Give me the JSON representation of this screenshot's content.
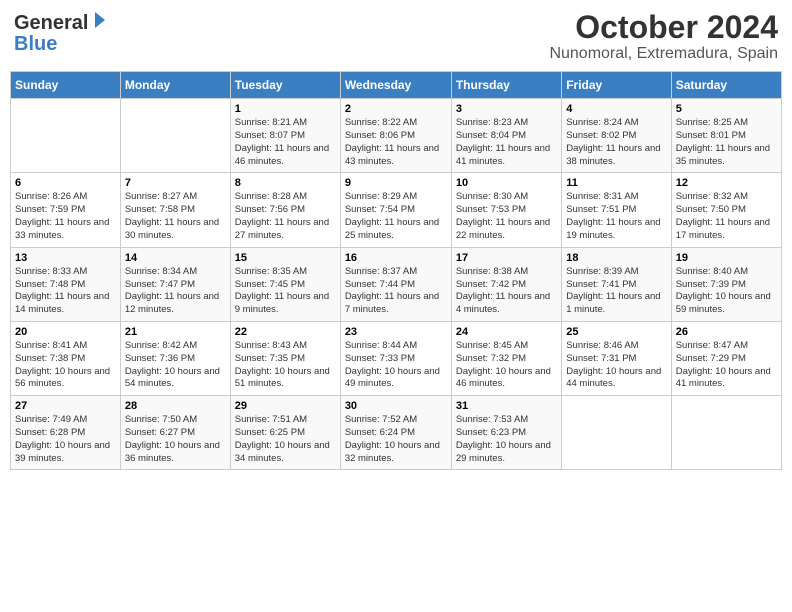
{
  "logo": {
    "general": "General",
    "blue": "Blue"
  },
  "title": "October 2024",
  "subtitle": "Nunomoral, Extremadura, Spain",
  "weekdays": [
    "Sunday",
    "Monday",
    "Tuesday",
    "Wednesday",
    "Thursday",
    "Friday",
    "Saturday"
  ],
  "weeks": [
    [
      {
        "day": "",
        "info": ""
      },
      {
        "day": "",
        "info": ""
      },
      {
        "day": "1",
        "info": "Sunrise: 8:21 AM\nSunset: 8:07 PM\nDaylight: 11 hours and 46 minutes."
      },
      {
        "day": "2",
        "info": "Sunrise: 8:22 AM\nSunset: 8:06 PM\nDaylight: 11 hours and 43 minutes."
      },
      {
        "day": "3",
        "info": "Sunrise: 8:23 AM\nSunset: 8:04 PM\nDaylight: 11 hours and 41 minutes."
      },
      {
        "day": "4",
        "info": "Sunrise: 8:24 AM\nSunset: 8:02 PM\nDaylight: 11 hours and 38 minutes."
      },
      {
        "day": "5",
        "info": "Sunrise: 8:25 AM\nSunset: 8:01 PM\nDaylight: 11 hours and 35 minutes."
      }
    ],
    [
      {
        "day": "6",
        "info": "Sunrise: 8:26 AM\nSunset: 7:59 PM\nDaylight: 11 hours and 33 minutes."
      },
      {
        "day": "7",
        "info": "Sunrise: 8:27 AM\nSunset: 7:58 PM\nDaylight: 11 hours and 30 minutes."
      },
      {
        "day": "8",
        "info": "Sunrise: 8:28 AM\nSunset: 7:56 PM\nDaylight: 11 hours and 27 minutes."
      },
      {
        "day": "9",
        "info": "Sunrise: 8:29 AM\nSunset: 7:54 PM\nDaylight: 11 hours and 25 minutes."
      },
      {
        "day": "10",
        "info": "Sunrise: 8:30 AM\nSunset: 7:53 PM\nDaylight: 11 hours and 22 minutes."
      },
      {
        "day": "11",
        "info": "Sunrise: 8:31 AM\nSunset: 7:51 PM\nDaylight: 11 hours and 19 minutes."
      },
      {
        "day": "12",
        "info": "Sunrise: 8:32 AM\nSunset: 7:50 PM\nDaylight: 11 hours and 17 minutes."
      }
    ],
    [
      {
        "day": "13",
        "info": "Sunrise: 8:33 AM\nSunset: 7:48 PM\nDaylight: 11 hours and 14 minutes."
      },
      {
        "day": "14",
        "info": "Sunrise: 8:34 AM\nSunset: 7:47 PM\nDaylight: 11 hours and 12 minutes."
      },
      {
        "day": "15",
        "info": "Sunrise: 8:35 AM\nSunset: 7:45 PM\nDaylight: 11 hours and 9 minutes."
      },
      {
        "day": "16",
        "info": "Sunrise: 8:37 AM\nSunset: 7:44 PM\nDaylight: 11 hours and 7 minutes."
      },
      {
        "day": "17",
        "info": "Sunrise: 8:38 AM\nSunset: 7:42 PM\nDaylight: 11 hours and 4 minutes."
      },
      {
        "day": "18",
        "info": "Sunrise: 8:39 AM\nSunset: 7:41 PM\nDaylight: 11 hours and 1 minute."
      },
      {
        "day": "19",
        "info": "Sunrise: 8:40 AM\nSunset: 7:39 PM\nDaylight: 10 hours and 59 minutes."
      }
    ],
    [
      {
        "day": "20",
        "info": "Sunrise: 8:41 AM\nSunset: 7:38 PM\nDaylight: 10 hours and 56 minutes."
      },
      {
        "day": "21",
        "info": "Sunrise: 8:42 AM\nSunset: 7:36 PM\nDaylight: 10 hours and 54 minutes."
      },
      {
        "day": "22",
        "info": "Sunrise: 8:43 AM\nSunset: 7:35 PM\nDaylight: 10 hours and 51 minutes."
      },
      {
        "day": "23",
        "info": "Sunrise: 8:44 AM\nSunset: 7:33 PM\nDaylight: 10 hours and 49 minutes."
      },
      {
        "day": "24",
        "info": "Sunrise: 8:45 AM\nSunset: 7:32 PM\nDaylight: 10 hours and 46 minutes."
      },
      {
        "day": "25",
        "info": "Sunrise: 8:46 AM\nSunset: 7:31 PM\nDaylight: 10 hours and 44 minutes."
      },
      {
        "day": "26",
        "info": "Sunrise: 8:47 AM\nSunset: 7:29 PM\nDaylight: 10 hours and 41 minutes."
      }
    ],
    [
      {
        "day": "27",
        "info": "Sunrise: 7:49 AM\nSunset: 6:28 PM\nDaylight: 10 hours and 39 minutes."
      },
      {
        "day": "28",
        "info": "Sunrise: 7:50 AM\nSunset: 6:27 PM\nDaylight: 10 hours and 36 minutes."
      },
      {
        "day": "29",
        "info": "Sunrise: 7:51 AM\nSunset: 6:25 PM\nDaylight: 10 hours and 34 minutes."
      },
      {
        "day": "30",
        "info": "Sunrise: 7:52 AM\nSunset: 6:24 PM\nDaylight: 10 hours and 32 minutes."
      },
      {
        "day": "31",
        "info": "Sunrise: 7:53 AM\nSunset: 6:23 PM\nDaylight: 10 hours and 29 minutes."
      },
      {
        "day": "",
        "info": ""
      },
      {
        "day": "",
        "info": ""
      }
    ]
  ]
}
